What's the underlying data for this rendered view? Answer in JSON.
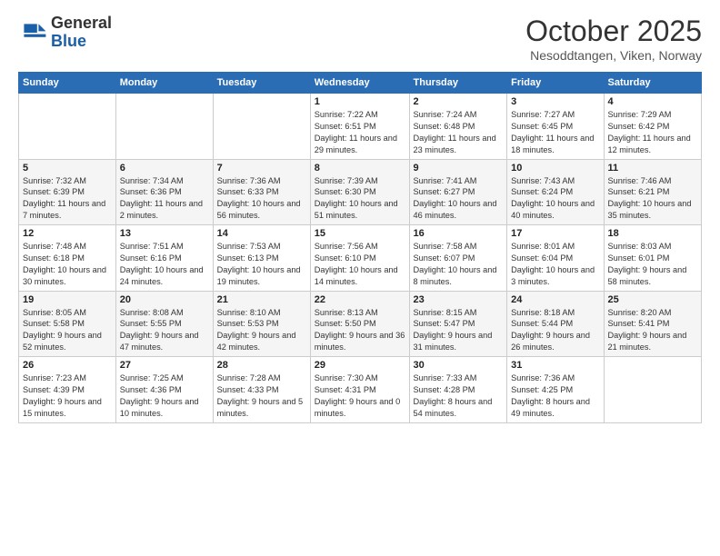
{
  "header": {
    "logo_general": "General",
    "logo_blue": "Blue",
    "month": "October 2025",
    "location": "Nesoddtangen, Viken, Norway"
  },
  "weekdays": [
    "Sunday",
    "Monday",
    "Tuesday",
    "Wednesday",
    "Thursday",
    "Friday",
    "Saturday"
  ],
  "weeks": [
    [
      null,
      null,
      null,
      {
        "day": 1,
        "sunrise": "7:22 AM",
        "sunset": "6:51 PM",
        "daylight": "11 hours and 29 minutes."
      },
      {
        "day": 2,
        "sunrise": "7:24 AM",
        "sunset": "6:48 PM",
        "daylight": "11 hours and 23 minutes."
      },
      {
        "day": 3,
        "sunrise": "7:27 AM",
        "sunset": "6:45 PM",
        "daylight": "11 hours and 18 minutes."
      },
      {
        "day": 4,
        "sunrise": "7:29 AM",
        "sunset": "6:42 PM",
        "daylight": "11 hours and 12 minutes."
      }
    ],
    [
      {
        "day": 5,
        "sunrise": "7:32 AM",
        "sunset": "6:39 PM",
        "daylight": "11 hours and 7 minutes."
      },
      {
        "day": 6,
        "sunrise": "7:34 AM",
        "sunset": "6:36 PM",
        "daylight": "11 hours and 2 minutes."
      },
      {
        "day": 7,
        "sunrise": "7:36 AM",
        "sunset": "6:33 PM",
        "daylight": "10 hours and 56 minutes."
      },
      {
        "day": 8,
        "sunrise": "7:39 AM",
        "sunset": "6:30 PM",
        "daylight": "10 hours and 51 minutes."
      },
      {
        "day": 9,
        "sunrise": "7:41 AM",
        "sunset": "6:27 PM",
        "daylight": "10 hours and 46 minutes."
      },
      {
        "day": 10,
        "sunrise": "7:43 AM",
        "sunset": "6:24 PM",
        "daylight": "10 hours and 40 minutes."
      },
      {
        "day": 11,
        "sunrise": "7:46 AM",
        "sunset": "6:21 PM",
        "daylight": "10 hours and 35 minutes."
      }
    ],
    [
      {
        "day": 12,
        "sunrise": "7:48 AM",
        "sunset": "6:18 PM",
        "daylight": "10 hours and 30 minutes."
      },
      {
        "day": 13,
        "sunrise": "7:51 AM",
        "sunset": "6:16 PM",
        "daylight": "10 hours and 24 minutes."
      },
      {
        "day": 14,
        "sunrise": "7:53 AM",
        "sunset": "6:13 PM",
        "daylight": "10 hours and 19 minutes."
      },
      {
        "day": 15,
        "sunrise": "7:56 AM",
        "sunset": "6:10 PM",
        "daylight": "10 hours and 14 minutes."
      },
      {
        "day": 16,
        "sunrise": "7:58 AM",
        "sunset": "6:07 PM",
        "daylight": "10 hours and 8 minutes."
      },
      {
        "day": 17,
        "sunrise": "8:01 AM",
        "sunset": "6:04 PM",
        "daylight": "10 hours and 3 minutes."
      },
      {
        "day": 18,
        "sunrise": "8:03 AM",
        "sunset": "6:01 PM",
        "daylight": "9 hours and 58 minutes."
      }
    ],
    [
      {
        "day": 19,
        "sunrise": "8:05 AM",
        "sunset": "5:58 PM",
        "daylight": "9 hours and 52 minutes."
      },
      {
        "day": 20,
        "sunrise": "8:08 AM",
        "sunset": "5:55 PM",
        "daylight": "9 hours and 47 minutes."
      },
      {
        "day": 21,
        "sunrise": "8:10 AM",
        "sunset": "5:53 PM",
        "daylight": "9 hours and 42 minutes."
      },
      {
        "day": 22,
        "sunrise": "8:13 AM",
        "sunset": "5:50 PM",
        "daylight": "9 hours and 36 minutes."
      },
      {
        "day": 23,
        "sunrise": "8:15 AM",
        "sunset": "5:47 PM",
        "daylight": "9 hours and 31 minutes."
      },
      {
        "day": 24,
        "sunrise": "8:18 AM",
        "sunset": "5:44 PM",
        "daylight": "9 hours and 26 minutes."
      },
      {
        "day": 25,
        "sunrise": "8:20 AM",
        "sunset": "5:41 PM",
        "daylight": "9 hours and 21 minutes."
      }
    ],
    [
      {
        "day": 26,
        "sunrise": "7:23 AM",
        "sunset": "4:39 PM",
        "daylight": "9 hours and 15 minutes."
      },
      {
        "day": 27,
        "sunrise": "7:25 AM",
        "sunset": "4:36 PM",
        "daylight": "9 hours and 10 minutes."
      },
      {
        "day": 28,
        "sunrise": "7:28 AM",
        "sunset": "4:33 PM",
        "daylight": "9 hours and 5 minutes."
      },
      {
        "day": 29,
        "sunrise": "7:30 AM",
        "sunset": "4:31 PM",
        "daylight": "9 hours and 0 minutes."
      },
      {
        "day": 30,
        "sunrise": "7:33 AM",
        "sunset": "4:28 PM",
        "daylight": "8 hours and 54 minutes."
      },
      {
        "day": 31,
        "sunrise": "7:36 AM",
        "sunset": "4:25 PM",
        "daylight": "8 hours and 49 minutes."
      },
      null
    ]
  ],
  "labels": {
    "sunrise": "Sunrise:",
    "sunset": "Sunset:",
    "daylight": "Daylight:"
  }
}
